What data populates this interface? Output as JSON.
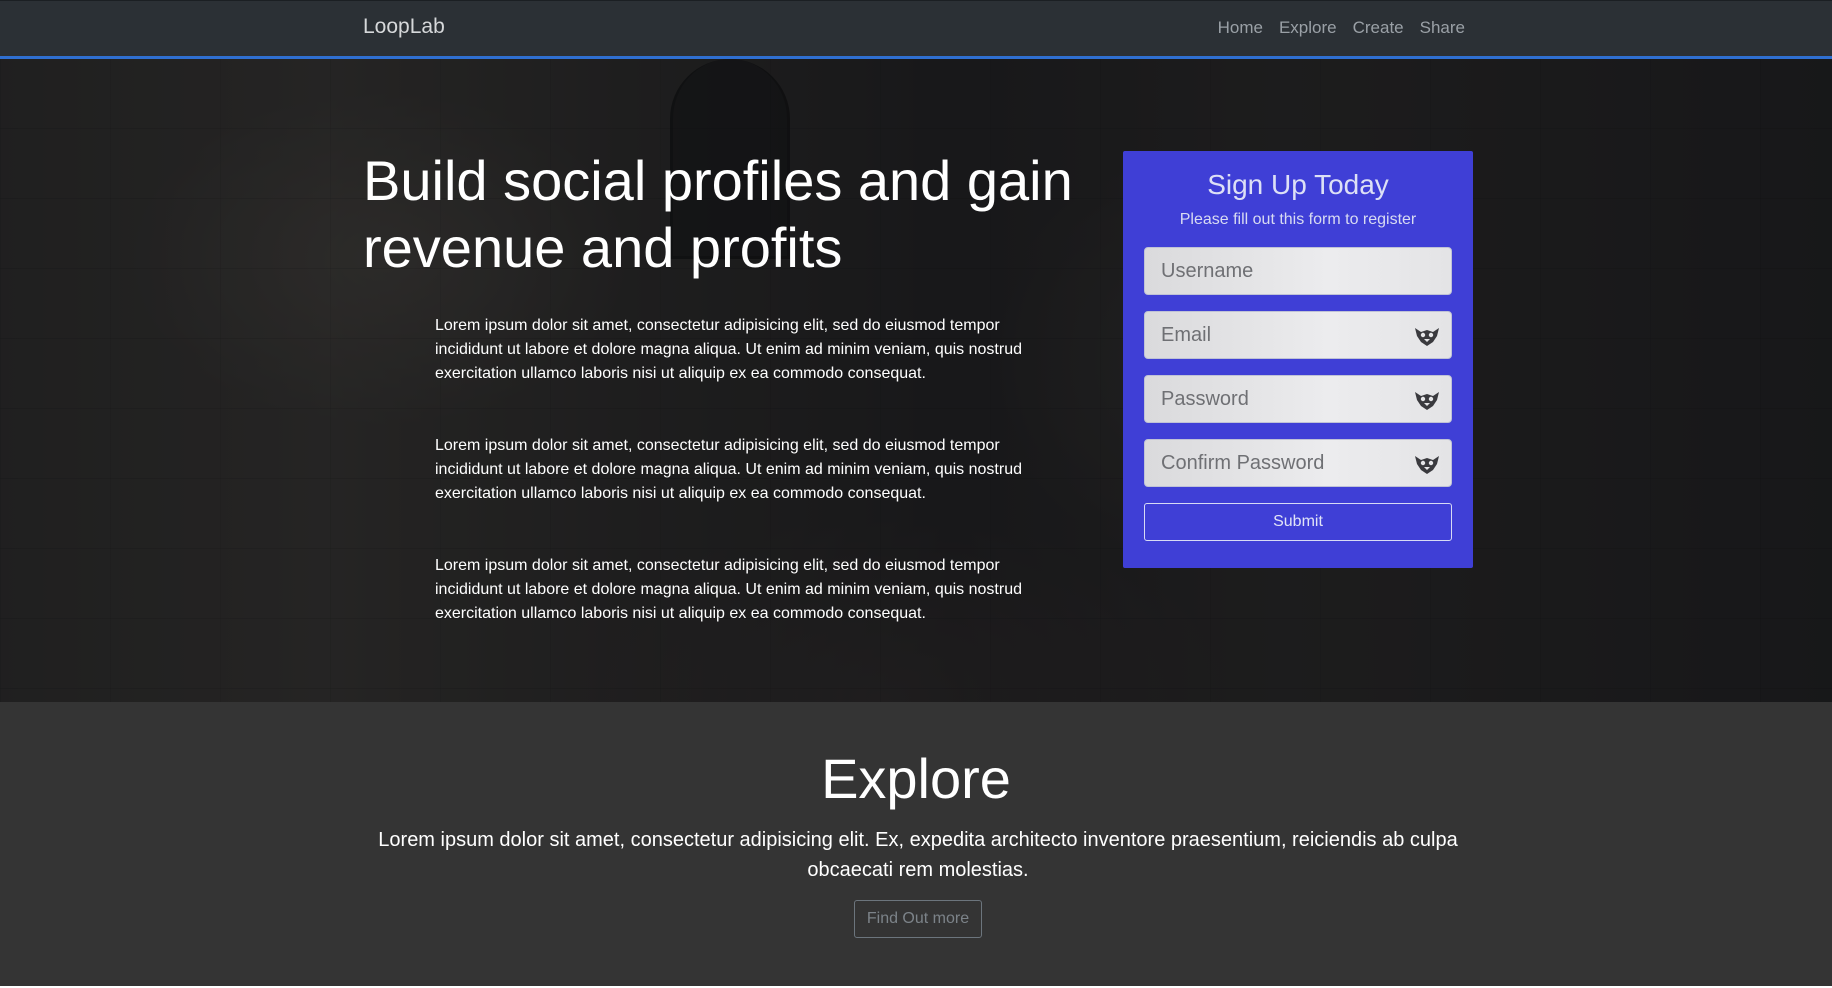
{
  "navbar": {
    "brand": "LoopLab",
    "links": [
      "Home",
      "Explore",
      "Create",
      "Share"
    ]
  },
  "hero": {
    "title": "Build social profiles and gain revenue and profits",
    "paragraphs": [
      "Lorem ipsum dolor sit amet, consectetur adipisicing elit, sed do eiusmod tempor incididunt ut labore et dolore magna aliqua. Ut enim ad minim veniam, quis nostrud exercitation ullamco laboris nisi ut aliquip ex ea commodo consequat.",
      "Lorem ipsum dolor sit amet, consectetur adipisicing elit, sed do eiusmod tempor incididunt ut labore et dolore magna aliqua. Ut enim ad minim veniam, quis nostrud exercitation ullamco laboris nisi ut aliquip ex ea commodo consequat.",
      "Lorem ipsum dolor sit amet, consectetur adipisicing elit, sed do eiusmod tempor incididunt ut labore et dolore magna aliqua. Ut enim ad minim veniam, quis nostrud exercitation ullamco laboris nisi ut aliquip ex ea commodo consequat."
    ]
  },
  "signup": {
    "title": "Sign Up Today",
    "subtitle": "Please fill out this form to register",
    "fields": {
      "username": {
        "placeholder": "Username",
        "value": "",
        "icon": null
      },
      "email": {
        "placeholder": "Email",
        "value": "",
        "icon": "password-manager-icon"
      },
      "password": {
        "placeholder": "Password",
        "value": "",
        "icon": "password-manager-icon"
      },
      "confirm_password": {
        "placeholder": "Confirm Password",
        "value": "",
        "icon": "password-manager-icon"
      }
    },
    "submit_label": "Submit"
  },
  "explore": {
    "title": "Explore",
    "text": "Lorem ipsum dolor sit amet, consectetur adipisicing elit. Ex, expedita architecto inventore praesentium, reiciendis ab culpa obcaecati rem molestias.",
    "button_label": "Find Out more"
  },
  "colors": {
    "navbar_bg": "#2b3035",
    "navbar_accent": "#2f6fd1",
    "signup_bg": "#3f3fd6",
    "explore_bg": "#343434"
  }
}
